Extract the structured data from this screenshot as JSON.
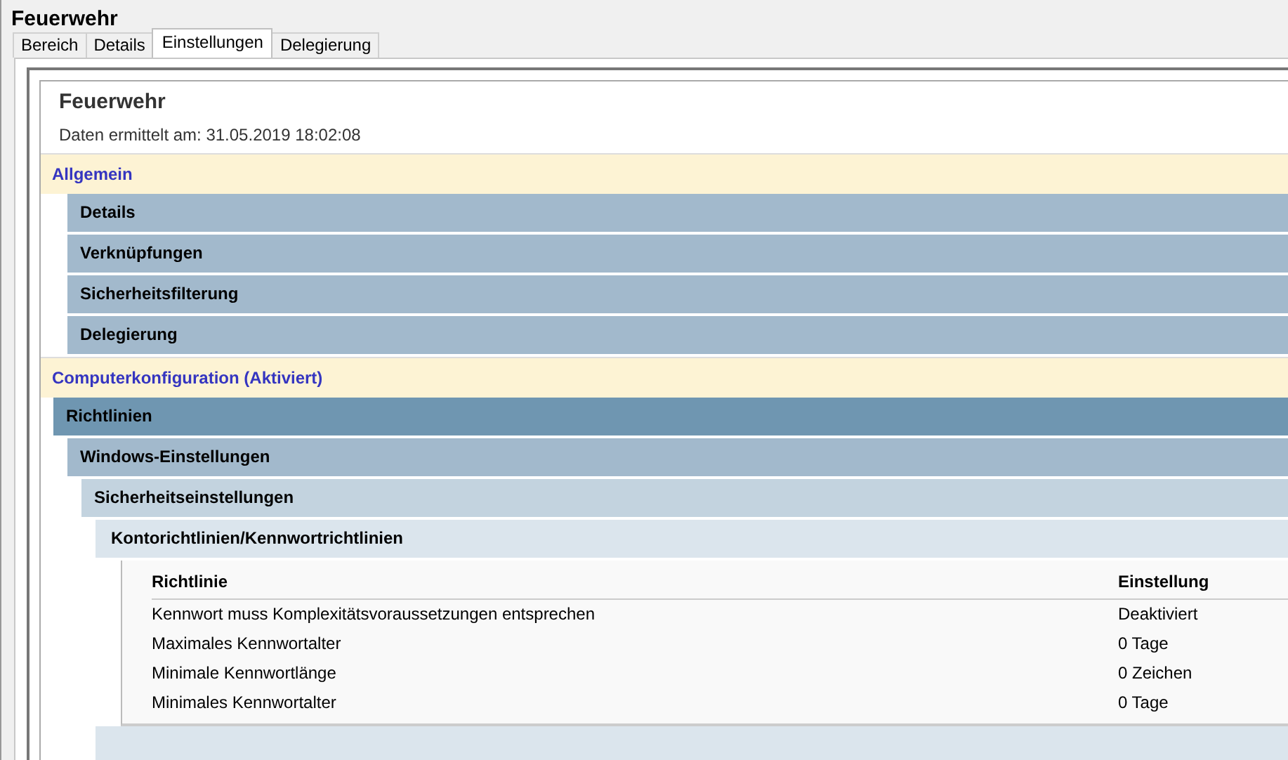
{
  "window": {
    "title": "Feuerwehr"
  },
  "tabs": [
    {
      "label": "Bereich",
      "selected": false
    },
    {
      "label": "Details",
      "selected": false
    },
    {
      "label": "Einstellungen",
      "selected": true
    },
    {
      "label": "Delegierung",
      "selected": false
    }
  ],
  "report": {
    "title": "Feuerwehr",
    "subtitle": "Daten ermittelt am: 31.05.2019 18:02:08",
    "sections": [
      {
        "title": "Allgemein",
        "items": [
          {
            "kind": "group",
            "title": "Details"
          },
          {
            "kind": "group",
            "title": "Verknüpfungen"
          },
          {
            "kind": "group",
            "title": "Sicherheitsfilterung"
          },
          {
            "kind": "group",
            "title": "Delegierung"
          }
        ]
      },
      {
        "title": "Computerkonfiguration (Aktiviert)",
        "items": [
          {
            "kind": "category",
            "title": "Richtlinien",
            "children": [
              {
                "kind": "group",
                "title": "Windows-Einstellungen",
                "children": [
                  {
                    "kind": "subgroup",
                    "title": "Sicherheitseinstellungen",
                    "children": [
                      {
                        "kind": "leaf",
                        "title": "Kontorichtlinien/Kennwortrichtlinien",
                        "table": {
                          "columns": [
                            "Richtlinie",
                            "Einstellung"
                          ],
                          "rows": [
                            [
                              "Kennwort muss Komplexitätsvoraussetzungen entsprechen",
                              "Deaktiviert"
                            ],
                            [
                              "Maximales Kennwortalter",
                              "0 Tage"
                            ],
                            [
                              "Minimale Kennwortlänge",
                              "0 Zeichen"
                            ],
                            [
                              "Minimales Kennwortalter",
                              "0 Tage"
                            ]
                          ]
                        }
                      },
                      {
                        "kind": "leaf"
                      }
                    ]
                  }
                ]
              }
            ]
          }
        ]
      }
    ]
  }
}
